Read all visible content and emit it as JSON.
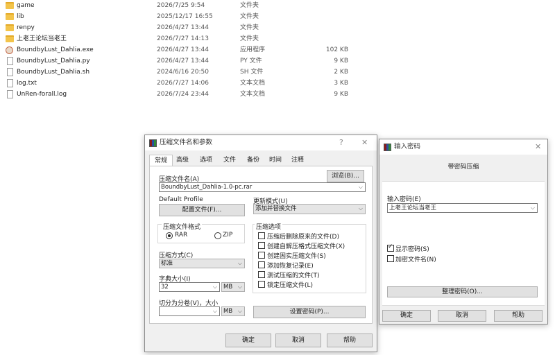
{
  "files": [
    {
      "name": "game",
      "date": "2026/7/25 9:54",
      "type": "文件夹",
      "size": "",
      "icon": "folder-icon"
    },
    {
      "name": "lib",
      "date": "2025/12/17 16:55",
      "type": "文件夹",
      "size": "",
      "icon": "folder-icon"
    },
    {
      "name": "renpy",
      "date": "2026/4/27 13:44",
      "type": "文件夹",
      "size": "",
      "icon": "folder-icon"
    },
    {
      "name": "上老王论坛当老王",
      "date": "2026/7/27 14:13",
      "type": "文件夹",
      "size": "",
      "icon": "folder-icon"
    },
    {
      "name": "BoundbyLust_Dahlia.exe",
      "date": "2026/4/27 13:44",
      "type": "应用程序",
      "size": "102 KB",
      "icon": "exe-icon"
    },
    {
      "name": "BoundbyLust_Dahlia.py",
      "date": "2026/4/27 13:44",
      "type": "PY 文件",
      "size": "9 KB",
      "icon": "file-icon"
    },
    {
      "name": "BoundbyLust_Dahlia.sh",
      "date": "2024/6/16 20:50",
      "type": "SH 文件",
      "size": "2 KB",
      "icon": "file-icon"
    },
    {
      "name": "log.txt",
      "date": "2026/7/27 14:06",
      "type": "文本文档",
      "size": "3 KB",
      "icon": "file-icon"
    },
    {
      "name": "UnRen-forall.log",
      "date": "2026/7/24 23:44",
      "type": "文本文档",
      "size": "9 KB",
      "icon": "file-icon"
    }
  ],
  "archive_dialog": {
    "title": "压缩文件名和参数",
    "help_glyph": "?",
    "close_glyph": "✕",
    "tabs": [
      "常规",
      "高级",
      "选项",
      "文件",
      "备份",
      "时间",
      "注释"
    ],
    "archive_name_label": "压缩文件名(A)",
    "browse_button": "浏览(B)...",
    "archive_name_value": "BoundbyLust_Dahlia-1.0-pc.rar",
    "default_profile_label": "Default Profile",
    "profiles_button": "配置文件(F)...",
    "update_mode_label": "更新模式(U)",
    "update_mode_value": "添加并替换文件",
    "format_group": "压缩文件格式",
    "format_rar": "RAR",
    "format_zip": "ZIP",
    "options_group": "压缩选项",
    "options": [
      {
        "label": "压缩后删除原来的文件(D)",
        "checked": false
      },
      {
        "label": "创建自解压格式压缩文件(X)",
        "checked": false
      },
      {
        "label": "创建固实压缩文件(S)",
        "checked": false
      },
      {
        "label": "添加恢复记录(E)",
        "checked": false
      },
      {
        "label": "测试压缩的文件(T)",
        "checked": false
      },
      {
        "label": "锁定压缩文件(L)",
        "checked": false
      }
    ],
    "method_label": "压缩方式(C)",
    "method_value": "标准",
    "dict_label": "字典大小(I)",
    "dict_value": "32",
    "dict_unit": "MB",
    "split_label": "切分为分卷(V)，大小",
    "split_value": "",
    "split_unit": "MB",
    "set_password_button": "设置密码(P)...",
    "ok_button": "确定",
    "cancel_button": "取消",
    "help_button": "帮助"
  },
  "password_dialog": {
    "title": "输入密码",
    "close_glyph": "✕",
    "heading": "带密码压缩",
    "password_label": "输入密码(E)",
    "password_value": "上老王论坛当老王",
    "show_password": "显示密码(S)",
    "show_password_checked": true,
    "encrypt_names": "加密文件名(N)",
    "encrypt_names_checked": false,
    "organize_button": "整理密码(O)...",
    "ok_button": "确定",
    "cancel_button": "取消",
    "help_button": "帮助"
  }
}
